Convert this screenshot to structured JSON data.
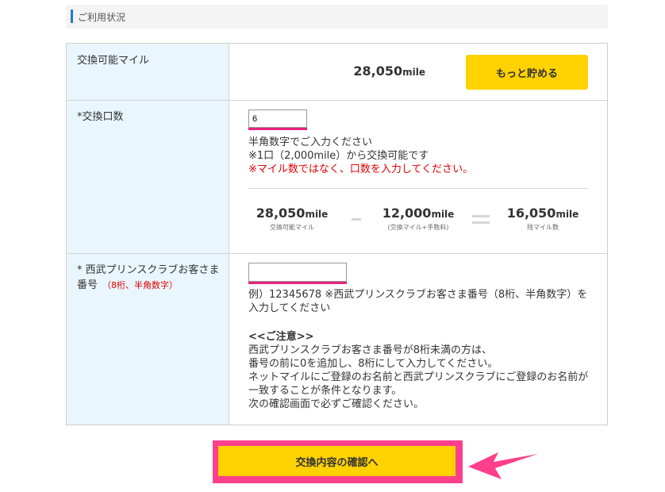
{
  "section": {
    "title": "ご利用状況"
  },
  "rows": {
    "available": {
      "label": "交換可能マイル",
      "miles_value": "28,050",
      "miles_unit": "mile",
      "more_button": "もっと貯める"
    },
    "units": {
      "label": "*交換口数",
      "input_value": "6",
      "help1": "半角数字でご入力ください",
      "help2": "※1口（2,000mile）から交換可能です",
      "warn": "※マイル数ではなく、口数を入力してください。",
      "calc": {
        "left_value": "28,050",
        "left_unit": "mile",
        "left_caption": "交換可能マイル",
        "mid_value": "12,000",
        "mid_unit": "mile",
        "mid_caption": "(交換マイル+手数料)",
        "right_value": "16,050",
        "right_unit": "mile",
        "right_caption": "残マイル数"
      }
    },
    "member": {
      "label_line1": "* 西武プリンスクラブお客さま",
      "label_line2": "番号",
      "label_note": "（8桁、半角数字）",
      "input_value": "",
      "example_line1": "例）12345678 ※西武プリンスクラブお客さま番号（8桁、半角数字）を",
      "example_line2": "入力してください",
      "notice_title": "<<ご注意>>",
      "notice_lines": [
        "西武プリンスクラブお客さま番号が8桁未満の方は、",
        "番号の前に0を追加し、8桁にして入力してください。",
        "ネットマイルにご登録のお名前と西武プリンスクラブにご登録のお名前が",
        "一致することが条件となります。",
        "次の確認画面で必ずご確認ください。"
      ]
    }
  },
  "confirm_button": "交換内容の確認へ",
  "colors": {
    "accent_yellow": "#ffd200",
    "highlight_pink": "#ff3f8b",
    "label_bg": "#eaf6fd",
    "warn_red": "#e00000"
  }
}
